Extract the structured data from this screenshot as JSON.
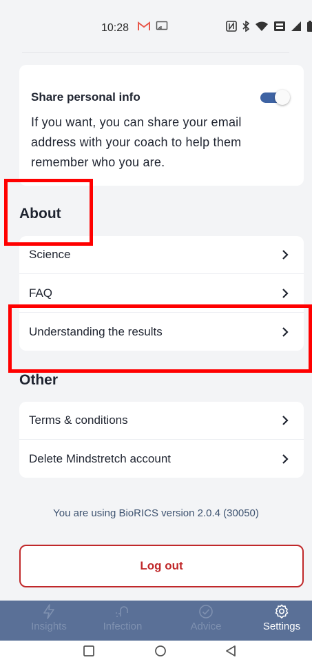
{
  "status_bar": {
    "time": "10:28",
    "left_icons": [
      "gmail-icon",
      "cast-icon"
    ],
    "right_icons": [
      "nfc-icon",
      "bluetooth-icon",
      "wifi-icon",
      "volte-icon",
      "signal-icon",
      "battery-icon"
    ]
  },
  "share_info": {
    "title": "Share personal info",
    "description": "If you want, you can share your email address with your coach to help them remember who you are.",
    "toggle_on": true
  },
  "about": {
    "title": "About",
    "items": [
      {
        "label": "Science"
      },
      {
        "label": "FAQ"
      },
      {
        "label": "Understanding the results"
      }
    ]
  },
  "other": {
    "title": "Other",
    "items": [
      {
        "label": "Terms & conditions"
      },
      {
        "label": "Delete Mindstretch account"
      }
    ]
  },
  "version_text": "You are using BioRICS version 2.0.4 (30050)",
  "logout_label": "Log out",
  "bottom_nav": {
    "items": [
      {
        "label": "Insights",
        "icon": "lightning-icon"
      },
      {
        "label": "Infection",
        "icon": "infection-icon"
      },
      {
        "label": "Advice",
        "icon": "check-circle-icon"
      },
      {
        "label": "Settings",
        "icon": "gear-icon",
        "active": true
      }
    ]
  },
  "colors": {
    "accent": "#3e63a3",
    "nav_bg": "#5a7097",
    "danger": "#c0282a",
    "annotation": "#ff0000"
  }
}
